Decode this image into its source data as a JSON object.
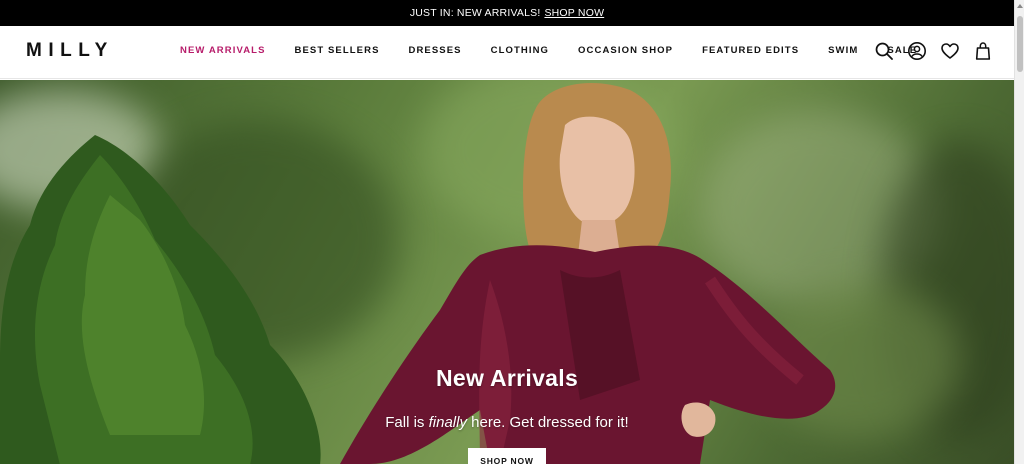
{
  "promo": {
    "text": "JUST IN: NEW ARRIVALS!",
    "link": "SHOP NOW"
  },
  "header": {
    "logo": "MILLY",
    "nav": [
      {
        "label": "NEW ARRIVALS",
        "active": true
      },
      {
        "label": "BEST SELLERS",
        "active": false
      },
      {
        "label": "DRESSES",
        "active": false
      },
      {
        "label": "CLOTHING",
        "active": false
      },
      {
        "label": "OCCASION SHOP",
        "active": false
      },
      {
        "label": "FEATURED EDITS",
        "active": false
      },
      {
        "label": "SWIM",
        "active": false
      },
      {
        "label": "SALE",
        "active": false
      }
    ],
    "icons": [
      "search-icon",
      "account-icon",
      "wishlist-heart-icon",
      "shopping-bag-icon"
    ]
  },
  "hero": {
    "title": "New Arrivals",
    "subtitle_before": "Fall is",
    "subtitle_emph": "finally",
    "subtitle_after": "here. Get dressed for it!",
    "cta": "SHOP NOW"
  },
  "colors": {
    "accent": "#b71c6a",
    "promo_bg": "#000000",
    "dress": "#6a1530"
  }
}
